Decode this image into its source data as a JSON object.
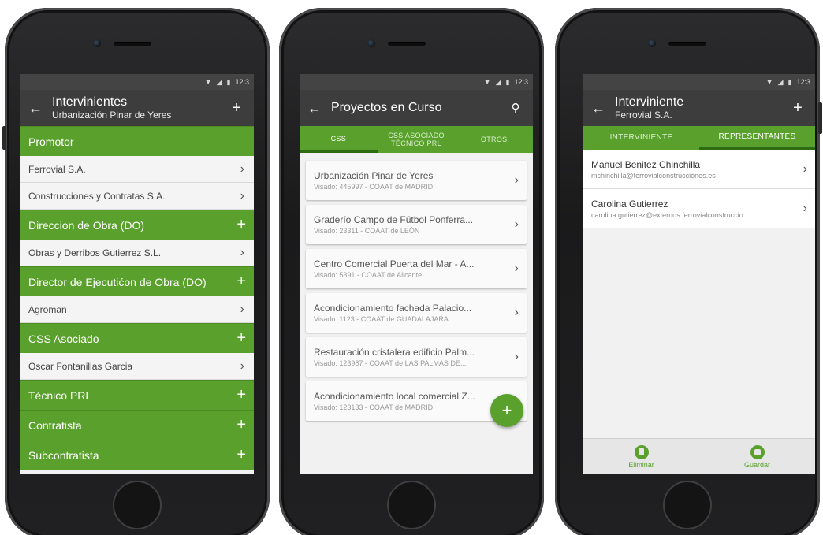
{
  "status": {
    "time": "12:3"
  },
  "phone1": {
    "title": "Intervinientes",
    "subtitle": "Urbanización Pinar de Yeres",
    "sections": [
      {
        "label": "Promotor",
        "items": [
          "Ferrovial S.A.",
          "Construcciones y Contratas S.A."
        ]
      },
      {
        "label": "Direccion de Obra (DO)",
        "items": [
          "Obras y Derribos Gutierrez S.L."
        ]
      },
      {
        "label": "Director de Ejecutićon de Obra (DO)",
        "items": [
          "Agroman"
        ]
      },
      {
        "label": "CSS Asociado",
        "items": [
          "Oscar Fontanillas Garcia"
        ]
      },
      {
        "label": "Técnico PRL",
        "items": []
      },
      {
        "label": "Contratista",
        "items": []
      },
      {
        "label": "Subcontratista",
        "items": []
      }
    ]
  },
  "phone2": {
    "title": "Proyectos en Curso",
    "tabs": [
      "CSS",
      "CSS ASOCIADO\nTÉCNICO PRL",
      "OTROS"
    ],
    "projects": [
      {
        "name": "Urbanización Pinar de Yeres",
        "visado": "Visado: 445997 - COAAT de MADRID"
      },
      {
        "name": "Graderío Campo de Fútbol Ponferra...",
        "visado": "Visado: 23311 - COAAT de LEÓN"
      },
      {
        "name": "Centro Comercial Puerta del Mar - A...",
        "visado": "Visado: 5391 - COAAT de Alicante"
      },
      {
        "name": "Acondicionamiento fachada Palacio...",
        "visado": "Visado: 1123 - COAAT de GUADALAJARA"
      },
      {
        "name": "Restauración cristalera edificio Palm...",
        "visado": "Visado: 123987 - COAAT de LAS PALMAS DE..."
      },
      {
        "name": "Acondicionamiento local comercial Z...",
        "visado": "Visado: 123133 - COAAT de MADRID"
      }
    ]
  },
  "phone3": {
    "title": "Interviniente",
    "subtitle": "Ferrovial S.A.",
    "tabs": [
      "INTERVINIENTE",
      "REPRESENTANTES"
    ],
    "reps": [
      {
        "name": "Manuel Benitez Chinchilla",
        "email": "mchinchilla@ferrovialconstrucciones.es"
      },
      {
        "name": "Carolina Gutierrez",
        "email": "carolina.gutierrez@externos.ferrovialconstruccio..."
      }
    ],
    "actions": {
      "delete": "Eliminar",
      "save": "Guardar"
    }
  },
  "colors": {
    "green": "#59a12c",
    "toolbar": "#3d3d3d"
  }
}
